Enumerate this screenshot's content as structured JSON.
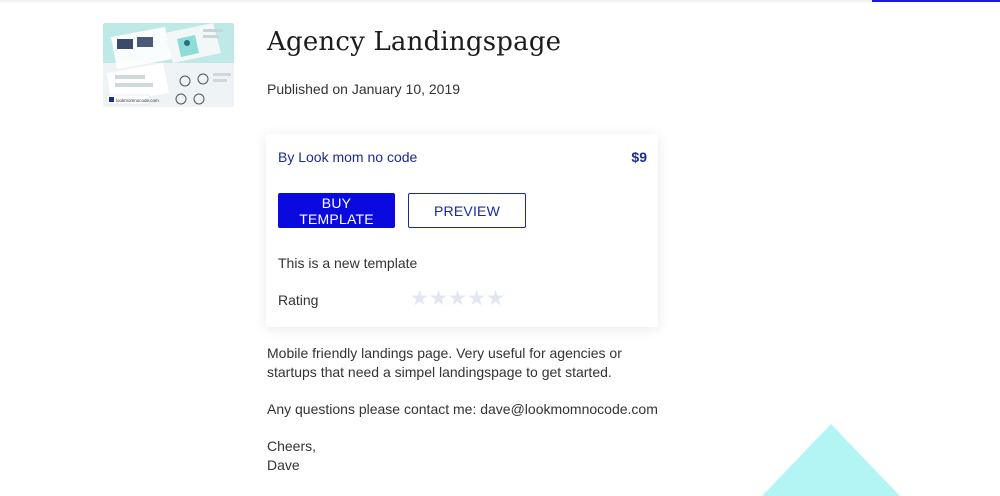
{
  "product": {
    "title": "Agency Landingspage",
    "published": "Published on January 10, 2019",
    "thumbnail_caption": "lookmomnocode.com"
  },
  "card": {
    "author": "By Look mom no code",
    "price": "$9",
    "buy_label": "BUY TEMPLATE",
    "preview_label": "PREVIEW",
    "note": "This is a new template",
    "rating_label": "Rating",
    "rating_value": 0,
    "rating_max": 5
  },
  "description": {
    "line1": "Mobile friendly landings page. Very useful for agencies or",
    "line2": "startups that need a simpel landingspage to get started.",
    "contact": "Any questions please contact me: dave@lookmomnocode.com",
    "signoff": "Cheers,",
    "name": "Dave"
  },
  "colors": {
    "accent": "#0909e0",
    "link": "#1a2a99",
    "decor_triangle": "#b3f5f5"
  }
}
